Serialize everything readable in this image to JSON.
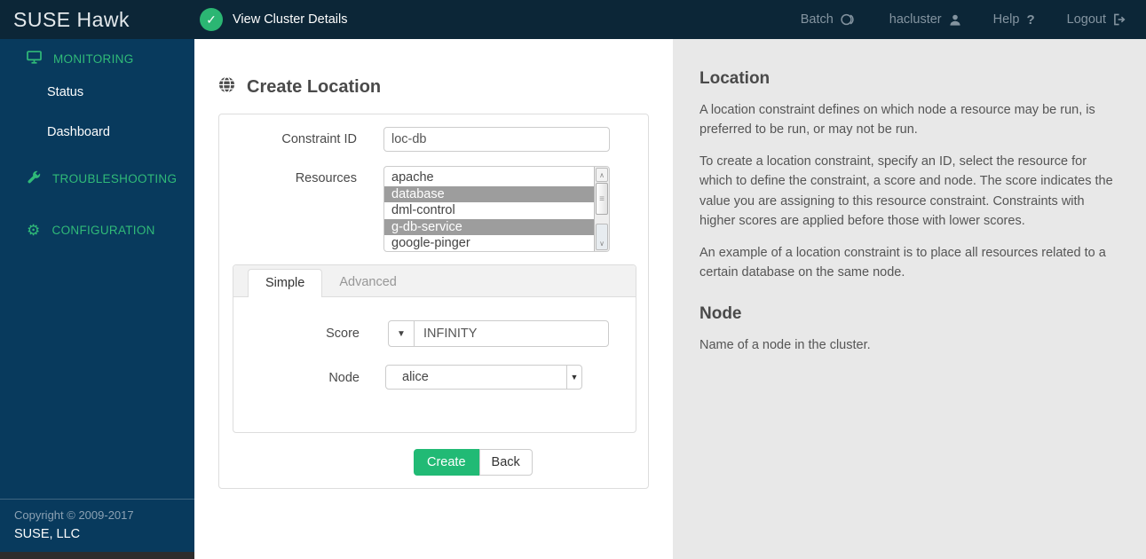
{
  "colors": {
    "topbar_bg": "#0c2637",
    "sidebar_bg": "#083a5d",
    "accent_green": "#30ba78",
    "button_green": "#21ba75",
    "help_panel_bg": "#e8e8e8",
    "selected_option_bg": "#9d9d9d"
  },
  "topbar": {
    "brand": "SUSE Hawk",
    "cluster_status": "View Cluster Details",
    "nav": [
      {
        "label": "Batch",
        "icon": "batch-icon"
      },
      {
        "label": "hacluster",
        "icon": "user-icon"
      },
      {
        "label": "Help",
        "icon": "help-icon"
      },
      {
        "label": "Logout",
        "icon": "logout-icon"
      }
    ]
  },
  "sidebar": {
    "sections": [
      {
        "label": "MONITORING",
        "icon": "monitor-icon",
        "items": [
          "Status",
          "Dashboard"
        ]
      },
      {
        "label": "TROUBLESHOOTING",
        "icon": "wrench-icon",
        "items": []
      },
      {
        "label": "CONFIGURATION",
        "icon": "gear-icon",
        "items": []
      }
    ],
    "footer": {
      "copyright": "Copyright © 2009-2017",
      "company": "SUSE, LLC"
    }
  },
  "main": {
    "title": "Create Location",
    "form": {
      "constraint_id": {
        "label": "Constraint ID",
        "value": "loc-db"
      },
      "resources": {
        "label": "Resources",
        "options": [
          {
            "label": "apache",
            "selected": false
          },
          {
            "label": "database",
            "selected": true
          },
          {
            "label": "dml-control",
            "selected": false
          },
          {
            "label": "g-db-service",
            "selected": true
          },
          {
            "label": "google-pinger",
            "selected": false
          }
        ]
      },
      "tabs": [
        {
          "label": "Simple",
          "active": true
        },
        {
          "label": "Advanced",
          "active": false
        }
      ],
      "score": {
        "label": "Score",
        "value": "INFINITY"
      },
      "node": {
        "label": "Node",
        "value": "alice"
      },
      "create_label": "Create",
      "back_label": "Back"
    }
  },
  "help": {
    "sections": [
      {
        "title": "Location",
        "paragraphs": [
          "A location constraint defines on which node a resource may be run, is preferred to be run, or may not be run.",
          "To create a location constraint, specify an ID, select the resource for which to define the constraint, a score and node. The score indicates the value you are assigning to this resource constraint. Constraints with higher scores are applied before those with lower scores.",
          "An example of a location constraint is to place all resources related to a certain database on the same node."
        ]
      },
      {
        "title": "Node",
        "paragraphs": [
          "Name of a node in the cluster."
        ]
      }
    ]
  }
}
